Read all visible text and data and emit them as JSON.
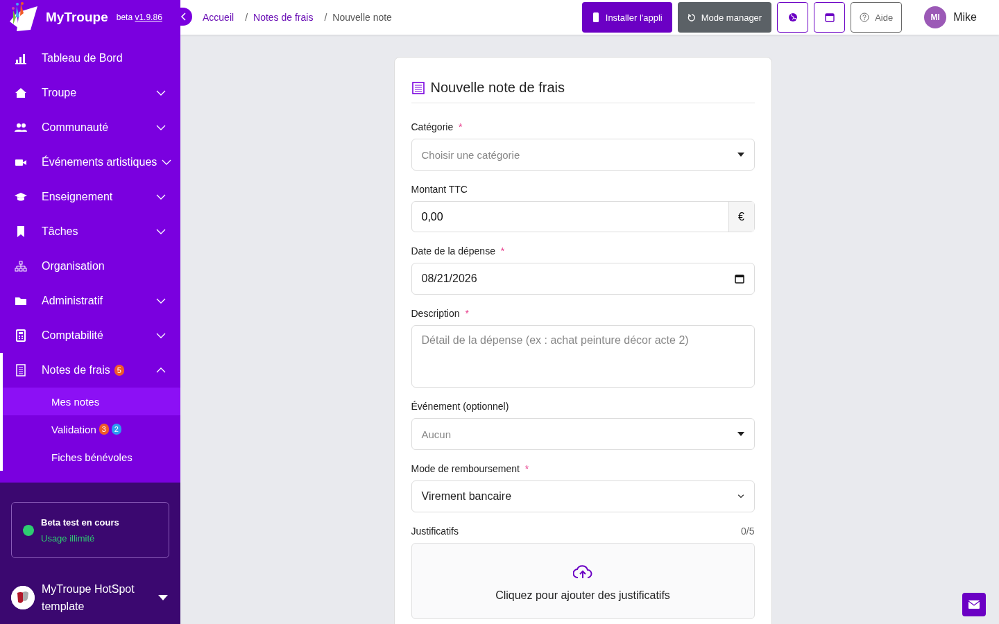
{
  "brand": {
    "name": "MyTroupe",
    "beta": "beta",
    "version": "v1.9.86"
  },
  "sidebar": {
    "items": [
      {
        "kind": "link",
        "label": "Tableau de Bord",
        "selected": false
      },
      {
        "kind": "group",
        "label": "Troupe",
        "expanded": false,
        "selected": false
      },
      {
        "kind": "group",
        "label": "Communauté",
        "expanded": false,
        "selected": false
      },
      {
        "kind": "group",
        "label": "Événements artistiques",
        "expanded": false,
        "selected": false
      },
      {
        "kind": "group",
        "label": "Enseignement",
        "expanded": false,
        "selected": false
      },
      {
        "kind": "group",
        "label": "Tâches",
        "expanded": false,
        "selected": false
      },
      {
        "kind": "link",
        "label": "Organisation",
        "selected": false
      },
      {
        "kind": "group",
        "label": "Administratif",
        "expanded": false,
        "selected": false
      },
      {
        "kind": "group",
        "label": "Comptabilité",
        "expanded": false,
        "selected": false
      },
      {
        "kind": "group",
        "label": "Notes de frais",
        "expanded": true,
        "selected": true,
        "badges": [
          {
            "text": "5",
            "color": "#f05a28"
          }
        ],
        "children": [
          {
            "label": "Mes notes",
            "selected": true
          },
          {
            "label": "Validation",
            "selected": false,
            "badges": [
              {
                "text": "3",
                "color": "#f05a28"
              },
              {
                "text": "2",
                "color": "#2d9cf0"
              }
            ]
          },
          {
            "label": "Fiches bénévoles",
            "selected": false
          }
        ]
      }
    ]
  },
  "beta_box": {
    "title": "Beta test en cours",
    "subtitle": "Usage illimité",
    "color": "#2ecc71"
  },
  "org_switcher": {
    "name": "MyTroupe HotSpot template"
  },
  "breadcrumbs": {
    "separator": "/",
    "items": [
      {
        "label": "Accueil",
        "link": true
      },
      {
        "label": "Notes de frais",
        "link": true
      },
      {
        "label": "Nouvelle note",
        "link": false
      }
    ]
  },
  "toolbar": {
    "install": "Installer l'appli",
    "manager": "Mode manager",
    "help": "Aide",
    "user_initials": "MI",
    "user_name": "Mike"
  },
  "form": {
    "title": "Nouvelle note de frais",
    "required_mark": "*",
    "fields": [
      {
        "kind": "select",
        "label": "Catégorie",
        "required": true,
        "placeholder": "Choisir une catégorie"
      },
      {
        "kind": "amount",
        "label": "Montant TTC",
        "required": false,
        "value": "0,00",
        "suffix": "€"
      },
      {
        "kind": "date",
        "label": "Date de la dépense",
        "required": true,
        "value": "08/21/2026"
      },
      {
        "kind": "textarea",
        "label": "Description",
        "required": true,
        "placeholder": "Détail de la dépense (ex : achat peinture décor acte 2)"
      },
      {
        "kind": "select",
        "label": "Événement (optionnel)",
        "required": false,
        "placeholder": "Aucun"
      },
      {
        "kind": "native",
        "label": "Mode de remboursement",
        "required": true,
        "value": "Virement bancaire"
      },
      {
        "kind": "upload",
        "label": "Justificatifs",
        "required": false,
        "counter": "0/5",
        "prompt": "Cliquez pour ajouter des justificatifs"
      }
    ]
  }
}
